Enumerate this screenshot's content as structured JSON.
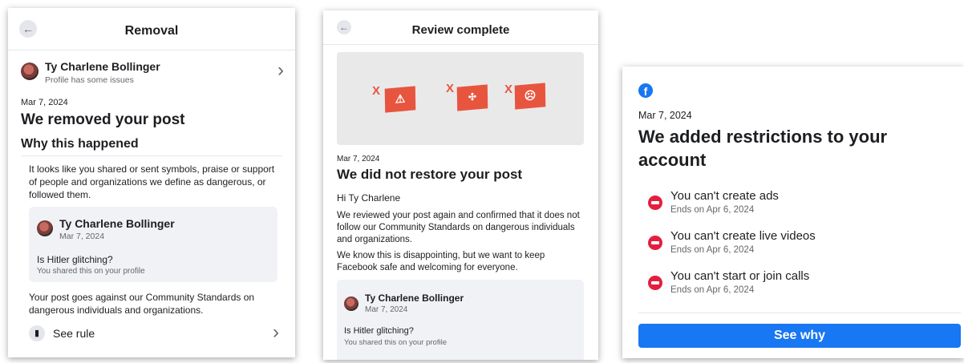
{
  "removal": {
    "title": "Removal",
    "profile_name": "Ty Charlene Bollinger",
    "profile_status": "Profile has some issues",
    "date": "Mar 7, 2024",
    "heading": "We removed your post",
    "why_heading": "Why this happened",
    "why_text": "It looks like you shared or sent symbols, praise or support of people and organizations we define as dangerous, or followed them.",
    "post_author": "Ty Charlene Bollinger",
    "post_date": "Mar 7, 2024",
    "post_text": "Is Hitler glitching?",
    "post_shared": "You shared this on your profile",
    "against_text": "Your post goes against our Community Standards on dangerous individuals and organizations.",
    "see_rule": "See rule"
  },
  "review": {
    "title": "Review complete",
    "x_marks": [
      "X",
      "X",
      "X"
    ],
    "date": "Mar 7, 2024",
    "heading": "We did not restore your post",
    "greeting": "Hi Ty Charlene",
    "para1": "We reviewed your post again and confirmed that it does not follow our Community Standards on dangerous individuals and organizations.",
    "para2": "We know this is disappointing, but we want to keep Facebook safe and welcoming for everyone.",
    "post_author": "Ty Charlene Bollinger",
    "post_date": "Mar 7, 2024",
    "post_text": "Is Hitler glitching?",
    "post_shared": "You shared this on your profile"
  },
  "restrictions": {
    "logo_letter": "f",
    "date": "Mar 7, 2024",
    "heading": "We added restrictions to your account",
    "items": [
      {
        "title": "You can't create ads",
        "ends": "Ends on Apr 6, 2024"
      },
      {
        "title": "You can't create live videos",
        "ends": "Ends on Apr 6, 2024"
      },
      {
        "title": "You can't start or join calls",
        "ends": "Ends on Apr 6, 2024"
      }
    ],
    "button": "See why"
  },
  "icons": {
    "back": "←",
    "chevron": "›",
    "rule_book": "▮"
  },
  "colors": {
    "facebook_blue": "#1877f2",
    "restriction_red": "#e41e3f",
    "illustration_orange": "#e8553e"
  }
}
